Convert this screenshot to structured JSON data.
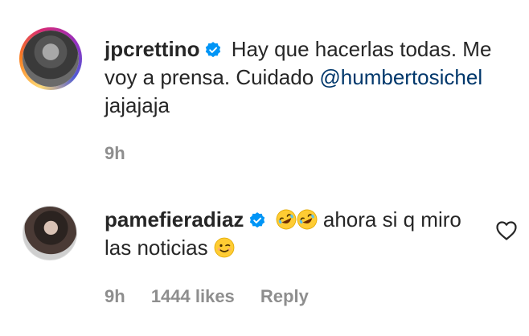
{
  "comments": [
    {
      "username": "jpcrettino",
      "verified": true,
      "text_1": "Hay que hacerlas todas. Me voy a prensa. Cuidado",
      "mention": "@humbertosichel",
      "text_2": "jajajaja",
      "time": "9h"
    },
    {
      "username": "pamefieradiaz",
      "verified": true,
      "emoji_lead": [
        "rolling-on-floor-laughing",
        "rolling-on-floor-laughing"
      ],
      "text_1": "ahora si q miro las noticias",
      "emoji_tail": "winking-face",
      "time": "9h",
      "likes": "1444 likes",
      "reply_label": "Reply"
    }
  ],
  "colors": {
    "text": "#262626",
    "meta": "#8e8e8e",
    "mention": "#00376b",
    "verified": "#0095f6"
  },
  "icons": {
    "verified": "verified-badge-icon",
    "like": "heart-outline-icon"
  }
}
